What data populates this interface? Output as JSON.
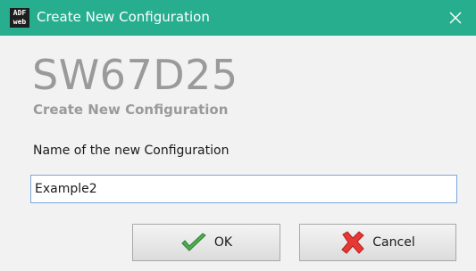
{
  "window": {
    "title": "Create New Configuration",
    "icon_text_top": "ADF",
    "icon_text_bottom": "web"
  },
  "header": {
    "model": "SW67D25",
    "subtitle": "Create New Configuration"
  },
  "form": {
    "label": "Name of the new Configuration",
    "value": "Example2"
  },
  "buttons": {
    "ok_label": "OK",
    "cancel_label": "Cancel"
  },
  "colors": {
    "titlebar": "#27ae8f",
    "ok_check": "#4caf50",
    "cancel_x": "#e53935"
  }
}
